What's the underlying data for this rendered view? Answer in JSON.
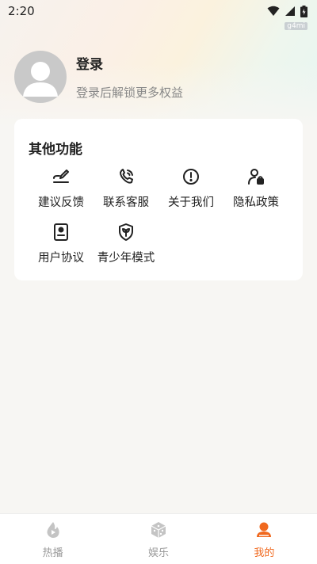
{
  "status": {
    "time": "2:20",
    "watermark": "g4mi"
  },
  "profile": {
    "title": "登录",
    "subtitle": "登录后解锁更多权益"
  },
  "features": {
    "title": "其他功能",
    "items": [
      {
        "label": "建议反馈",
        "icon": "feedback-pen-icon"
      },
      {
        "label": "联系客服",
        "icon": "phone-icon"
      },
      {
        "label": "关于我们",
        "icon": "info-icon"
      },
      {
        "label": "隐私政策",
        "icon": "privacy-user-lock-icon"
      },
      {
        "label": "用户协议",
        "icon": "agreement-document-icon"
      },
      {
        "label": "青少年模式",
        "icon": "youth-shield-icon"
      }
    ]
  },
  "tabbar": {
    "active_color": "#f0691f",
    "tabs": [
      {
        "label": "热播",
        "icon": "flame-play-icon"
      },
      {
        "label": "娱乐",
        "icon": "dice-icon"
      },
      {
        "label": "我的",
        "icon": "person-icon",
        "active": true
      }
    ]
  }
}
